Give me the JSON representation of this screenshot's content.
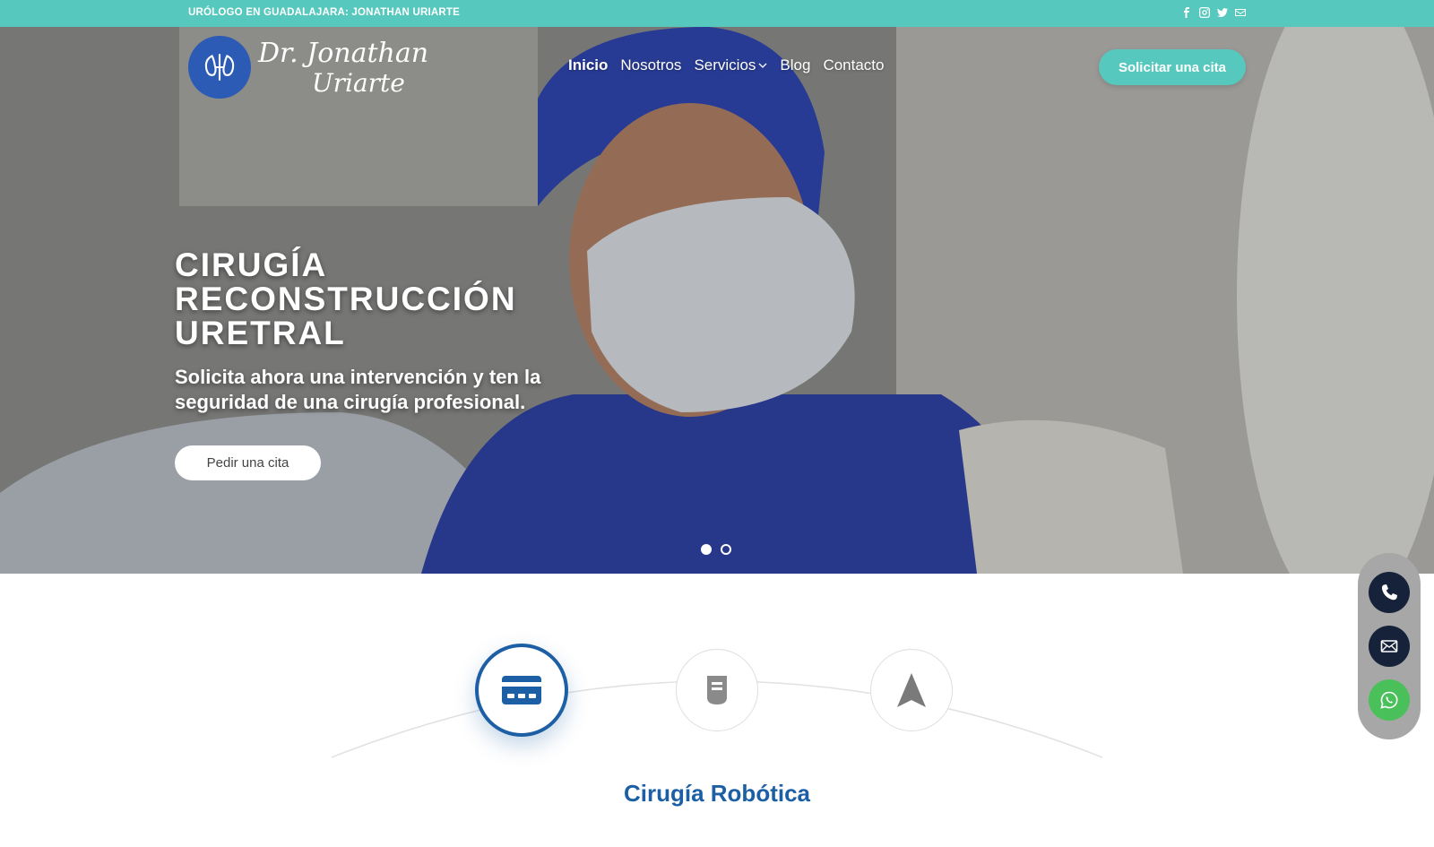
{
  "topbar": {
    "text": "URÓLOGO EN GUADALAJARA: JONATHAN URIARTE",
    "social_icons": [
      "facebook-icon",
      "instagram-icon",
      "twitter-icon",
      "email-icon"
    ]
  },
  "logo": {
    "line1": "Dr. Jonathan",
    "line2": "Uriarte"
  },
  "nav": {
    "items": [
      {
        "label": "Inicio",
        "active": true
      },
      {
        "label": "Nosotros"
      },
      {
        "label": "Servicios",
        "has_dropdown": true
      },
      {
        "label": "Blog"
      },
      {
        "label": "Contacto"
      }
    ]
  },
  "header": {
    "cta_label": "Solicitar una cita"
  },
  "hero": {
    "title": "CIRUGÍA RECONSTRUCCIÓN URETRAL",
    "subtitle": "Solicita ahora una intervención y ten la seguridad de una cirugía profesional.",
    "button_label": "Pedir una cita",
    "slides_total": 2,
    "active_slide": 1
  },
  "floating_contact": {
    "icons": [
      "phone-icon",
      "mail-icon",
      "whatsapp-icon"
    ]
  },
  "services": {
    "step_icons": [
      "credit-card-icon",
      "specimen-cup-icon",
      "navigation-arrow-icon"
    ],
    "active_step": 1,
    "section_title": "Cirugía Robótica"
  },
  "colors": {
    "teal": "#57c8bd",
    "blue": "#1d5fa5",
    "dark_navy": "#15223a",
    "whatsapp_green": "#4ac05a"
  }
}
